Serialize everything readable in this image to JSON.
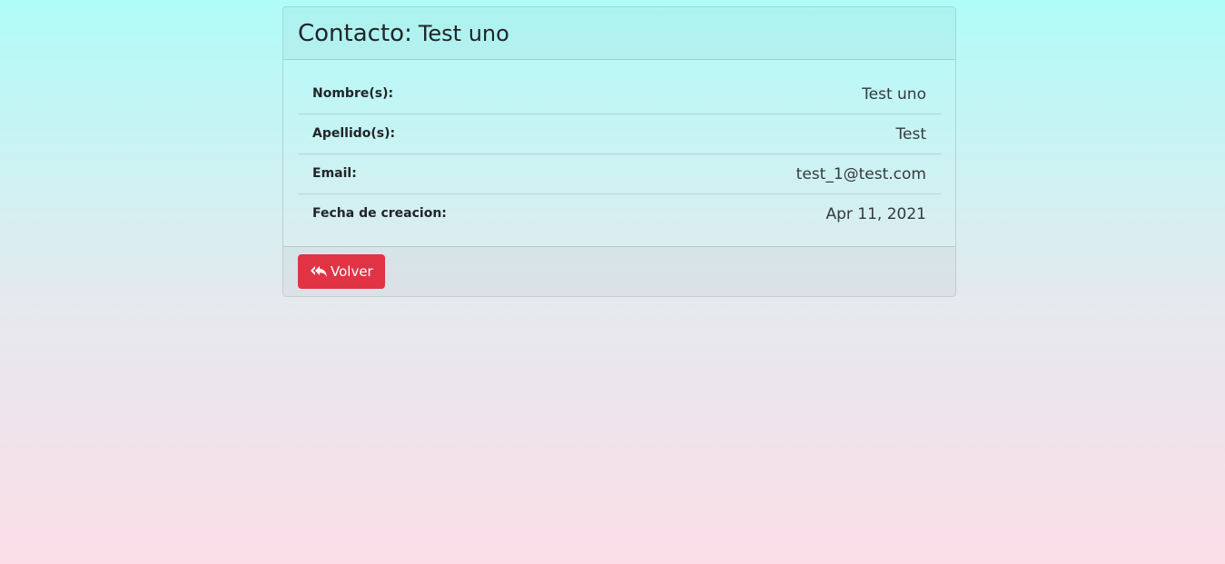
{
  "card": {
    "title_prefix": "Contacto:",
    "title_name": "Test uno"
  },
  "details": [
    {
      "label": "Nombre(s):",
      "value": "Test uno"
    },
    {
      "label": "Apellido(s):",
      "value": "Test"
    },
    {
      "label": "Email:",
      "value": "test_1@test.com"
    },
    {
      "label": "Fecha de creacion:",
      "value": "Apr 11, 2021"
    }
  ],
  "footer": {
    "back_label": "Volver",
    "back_icon": "reply-all-icon",
    "back_color": "#e03444"
  }
}
